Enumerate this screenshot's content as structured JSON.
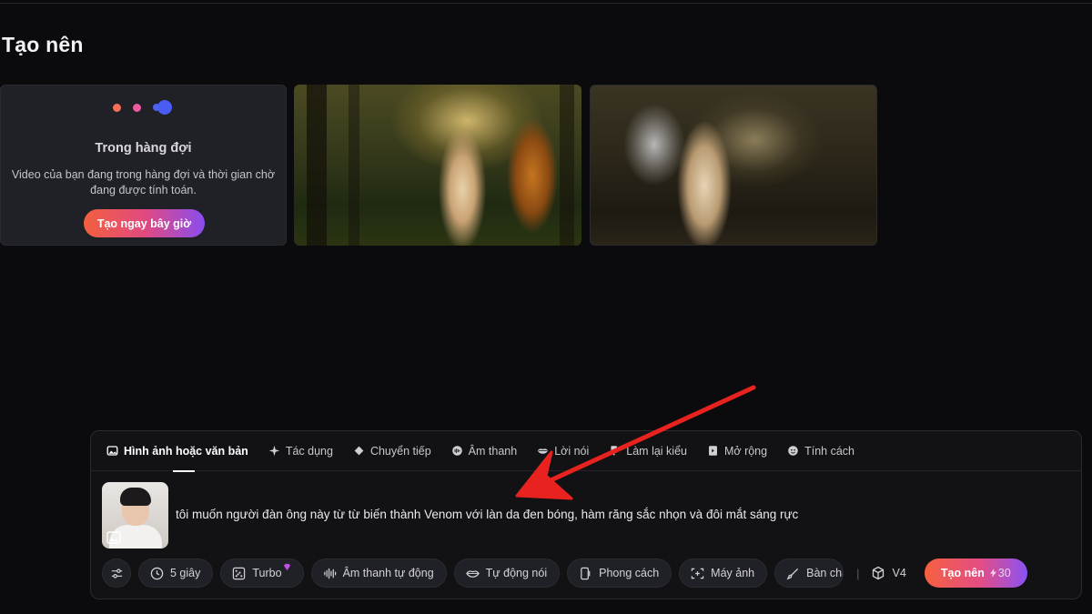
{
  "page": {
    "title": "Tạo nên"
  },
  "queue_card": {
    "title": "Trong hàng đợi",
    "description": "Video của bạn đang trong hàng đợi và thời gian chờ đang được tính toán.",
    "button_label": "Tạo ngay bây giờ"
  },
  "tabs": [
    {
      "label": "Hình ảnh hoặc văn bản",
      "icon": "image-icon",
      "active": true
    },
    {
      "label": "Tác dụng",
      "icon": "sparkle-icon"
    },
    {
      "label": "Chuyển tiếp",
      "icon": "transition-icon"
    },
    {
      "label": "Âm thanh",
      "icon": "audio-icon"
    },
    {
      "label": "Lời nói",
      "icon": "lips-icon"
    },
    {
      "label": "Làm lại kiểu",
      "icon": "restyle-icon"
    },
    {
      "label": "Mở rộng",
      "icon": "expand-icon"
    },
    {
      "label": "Tính cách",
      "icon": "face-icon"
    }
  ],
  "prompt": {
    "text": "tôi muốn người đàn ông này từ từ biến thành Venom với làn da đen bóng, hàm răng sắc nhọn và đôi mắt sáng rực"
  },
  "toolbar": {
    "duration": "5 giây",
    "mode": "Turbo",
    "audio": "Âm thanh tự động",
    "speech": "Tự động nói",
    "style": "Phong cách",
    "camera": "Máy ảnh",
    "brush": "Bàn chải",
    "separator": "|",
    "model": "V4",
    "generate_label": "Tạo nên",
    "credits": "30"
  },
  "colors": {
    "accent_gradient_start": "#f5603f",
    "accent_gradient_end": "#8a52f4",
    "annotation_arrow": "#e8231f"
  }
}
